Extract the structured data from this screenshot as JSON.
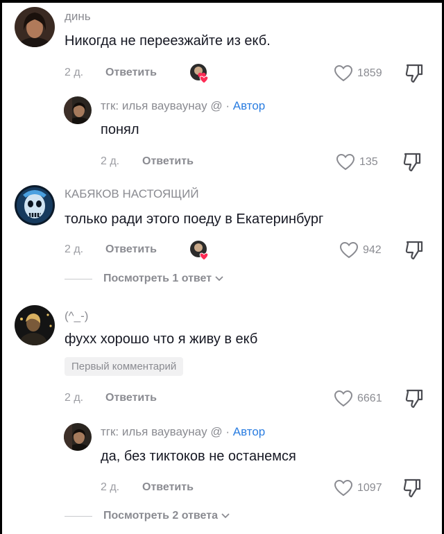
{
  "comments": [
    {
      "name": "динь",
      "text": "Никогда не переезжайте из екб.",
      "time": "2 д.",
      "reply_label": "Ответить",
      "likes": "1859",
      "author_liked": true,
      "reply": {
        "name": "тгк: илья вауваунay @",
        "author_sep": "·",
        "author_label": "Автор",
        "text": "понял",
        "time": "2 д.",
        "reply_label": "Ответить",
        "likes": "135"
      }
    },
    {
      "name": "КАБЯКОВ НАСТОЯЩИЙ",
      "text": "только ради этого поеду в Екатеринбург",
      "time": "2 д.",
      "reply_label": "Ответить",
      "likes": "942",
      "author_liked": true,
      "view_replies": "Посмотреть 1 ответ"
    },
    {
      "name": "(^_-)",
      "text": "фухх хорошо что я живу в екб",
      "badge": "Первый комментарий",
      "time": "2 д.",
      "reply_label": "Ответить",
      "likes": "6661",
      "reply": {
        "name": "тгк: илья вауваунay @",
        "author_sep": "·",
        "author_label": "Автор",
        "text": "да, без тиктоков не останемся",
        "time": "2 д.",
        "reply_label": "Ответить",
        "likes": "1097"
      },
      "view_replies": "Посмотреть 2 ответа"
    }
  ],
  "colors": {
    "author": "#2a7de1",
    "heart_badge": "#fe2c55"
  },
  "icons": {
    "like": "heart-outline-icon",
    "dislike": "thumb-down-icon",
    "expand": "chevron-down-icon"
  }
}
